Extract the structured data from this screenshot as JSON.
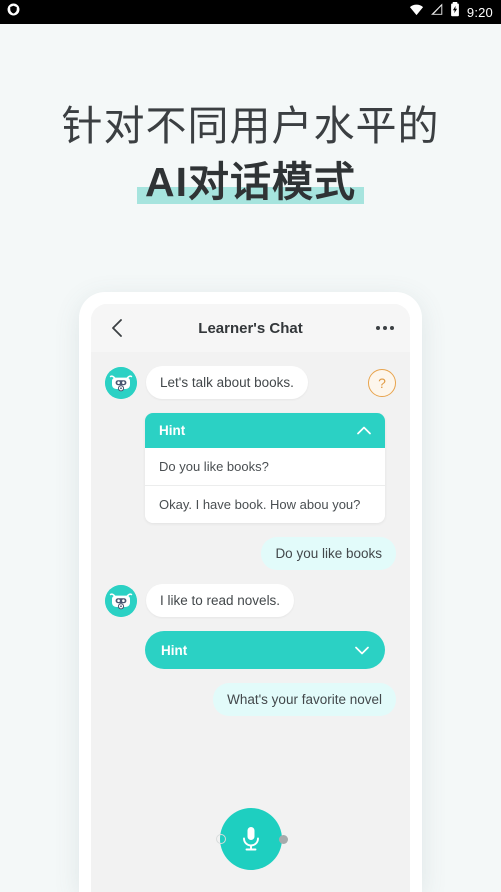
{
  "statusbar": {
    "left_icon": "shield-icon",
    "wifi_icon": "wifi-icon",
    "signal_icon": "no-signal-icon",
    "battery_icon": "battery-charging-icon",
    "time": "9:20"
  },
  "headline": {
    "line1": "针对不同用户水平的",
    "line2": "AI对话模式",
    "highlight_color": "#a6e4de"
  },
  "phone": {
    "header": {
      "back_icon": "back-chevron-icon",
      "title": "Learner's Chat",
      "more_icon": "more-options-icon"
    },
    "messages": [
      {
        "type": "bot",
        "avatar": "robot-avatar",
        "text": "Let's talk about books.",
        "help_label": "?"
      },
      {
        "type": "hint-expanded",
        "label": "Hint",
        "chevron": "chevron-up-icon",
        "items": [
          "Do you like books?",
          "Okay. I have book. How abou you?"
        ]
      },
      {
        "type": "user",
        "text": "Do you like books"
      },
      {
        "type": "bot",
        "avatar": "robot-avatar",
        "text": "I like to read novels."
      },
      {
        "type": "hint-collapsed",
        "label": "Hint",
        "chevron": "chevron-down-icon"
      },
      {
        "type": "user",
        "text": "What's your favorite novel"
      }
    ],
    "mic": {
      "icon": "microphone-icon"
    }
  },
  "colors": {
    "accent_teal": "#2bd1c4",
    "mic_teal": "#1ecfc0",
    "user_bubble": "#e2fbfa",
    "help_orange": "#e09b45",
    "page_bg": "#f4f8f8"
  }
}
